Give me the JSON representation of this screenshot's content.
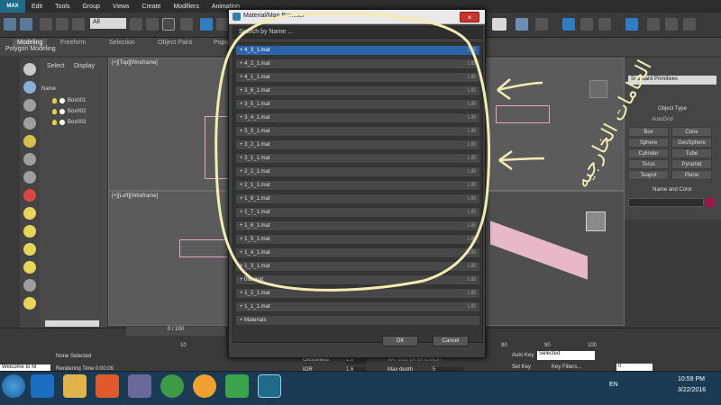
{
  "menu": [
    "MAX",
    "Edit",
    "Tools",
    "Group",
    "Views",
    "Create",
    "Modifiers",
    "Animation"
  ],
  "toolbar": {
    "all_filter": "All"
  },
  "ribbon": {
    "tabs": [
      "Modeling",
      "Freeform",
      "Selection",
      "Object Paint",
      "Populate"
    ],
    "subtitle": "Polygon Modeling"
  },
  "scene_explorer": {
    "tabs": [
      "Select",
      "Display"
    ],
    "header": "Name",
    "items": [
      "Box001",
      "Box002",
      "Box003"
    ]
  },
  "viewports": {
    "top": "[+][Top][Wireframe]",
    "left": "[+][Left][Wireframe]"
  },
  "dialog": {
    "title": "Material/Map Browser",
    "close": "×",
    "search_placeholder": "Search by Name ...",
    "materials": [
      "+ 4_3_1.mat",
      "+ 4_2_1.mat",
      "+ 4_1_1.mat",
      "+ 3_6_1.mat",
      "+ 3_5_1.mat",
      "+ 3_4_1.mat",
      "+ 3_3_1.mat",
      "+ 3_2_1.mat",
      "+ 3_1_1.mat",
      "+ 2_2_1.mat",
      "+ 2_1_1.mat",
      "+ 1_8_1.mat",
      "+ 1_7_1.mat",
      "+ 1_6_1.mat",
      "+ 1_5_1.mat",
      "+ 1_4_1.mat",
      "+ 1_3_1.mat",
      "+ 0lib.mat",
      "+ 1_2_1.mat",
      "+ 1_1_1.mat",
      "+ Materials"
    ],
    "lib_tag": "LIB",
    "ok": "OK",
    "cancel": "Cancel"
  },
  "command_panel": {
    "dropdown": "Standard Primitives",
    "group": "Object Type",
    "autogrid": "AutoGrid",
    "buttons": [
      "Box",
      "Cone",
      "Sphere",
      "GeoSphere",
      "Cylinder",
      "Tube",
      "Torus",
      "Pyramid",
      "Teapot",
      "Plane"
    ],
    "name_color": "Name and Color"
  },
  "status": {
    "maxscript": "Welcome to M",
    "none_selected": "None Selected",
    "render_time": "Rendering Time  0:00:00",
    "timeline": "0 / 100",
    "autokey": "Auto Key",
    "setkey": "Set Key",
    "selected": "Selected",
    "keyfilters": "Key Filters...",
    "frame": "0",
    "tick_10": "10",
    "tick_80": "80",
    "tick_90": "90",
    "tick_100": "100"
  },
  "material_editor": {
    "glossiness": "Glossiness",
    "ior": "IOR",
    "gloss_val": "1.0",
    "ior_val": "1.6",
    "max_depth": "Max depth",
    "depth_val": "5",
    "aa": "AA: 1/32 px  BF/CutOff"
  },
  "taskbar": {
    "lang": "EN",
    "time": "10:59 PM",
    "date": "3/22/2016"
  },
  "annotation": {
    "arabic": "الخامات الخارجيه"
  },
  "colors": {
    "selection": "#2b64a8",
    "close": "#c8352b",
    "annotation": "#f2ecb0"
  }
}
